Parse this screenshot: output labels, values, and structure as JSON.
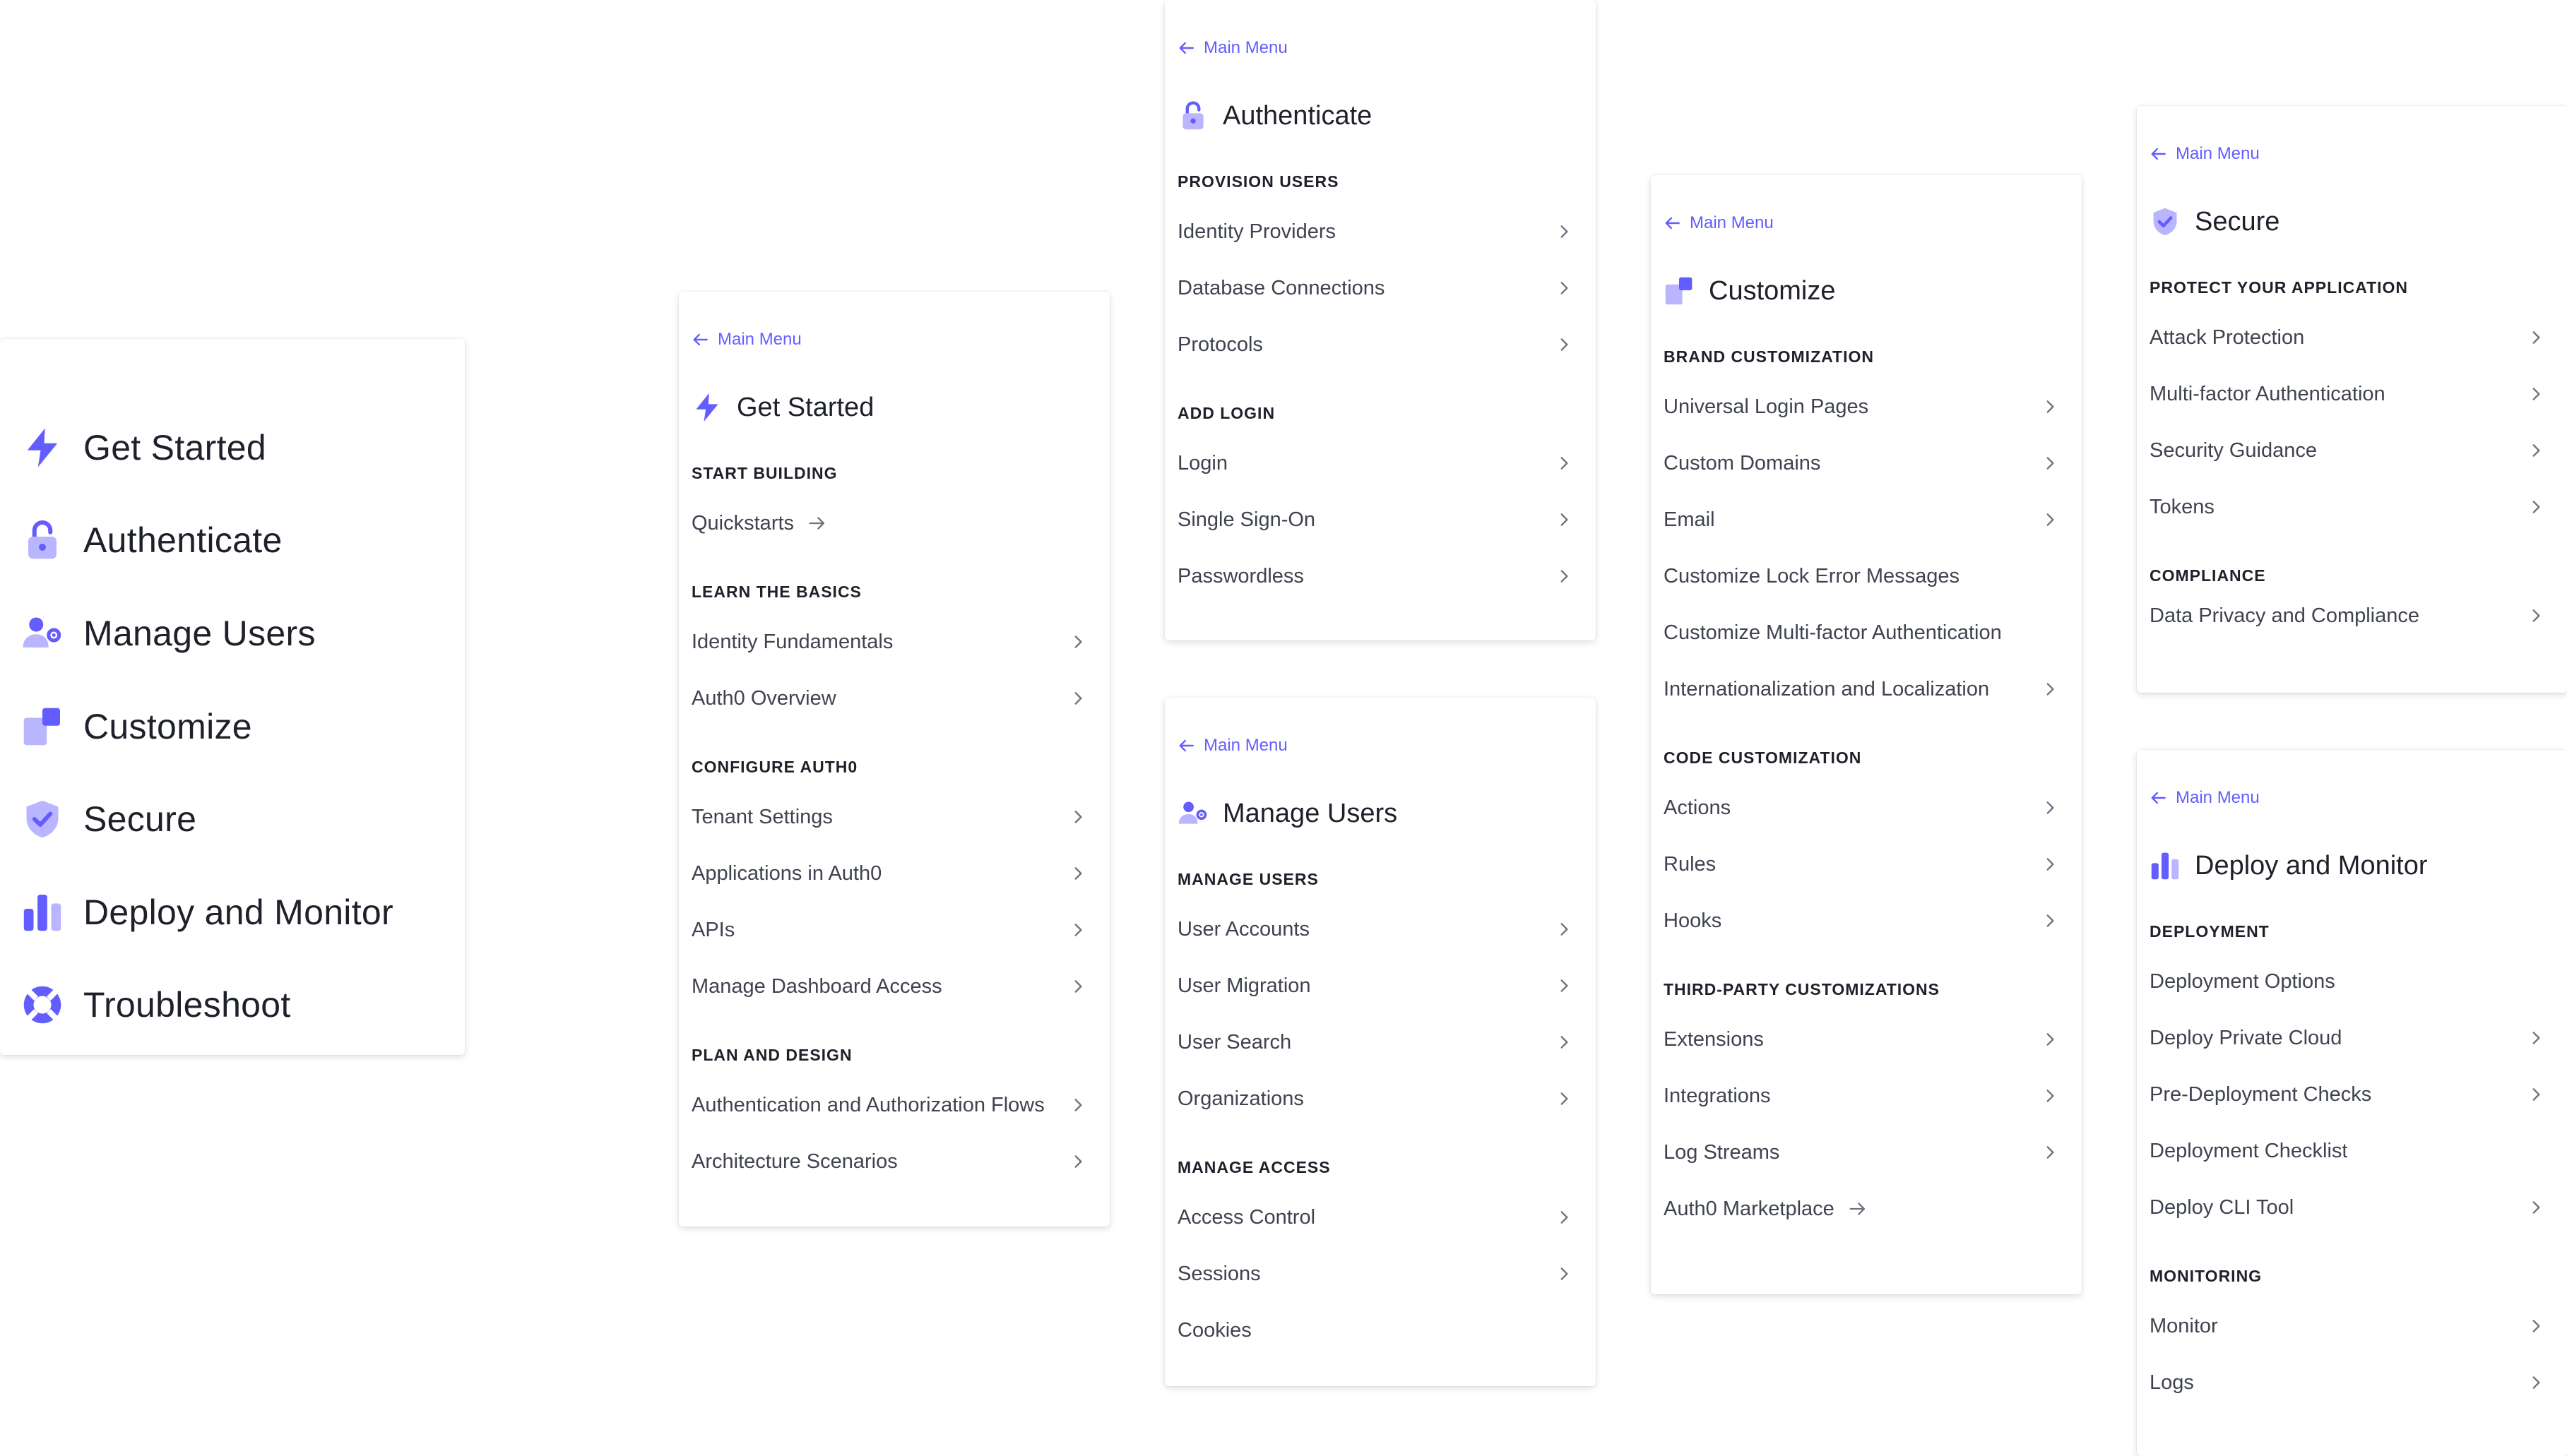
{
  "colors": {
    "accent": "#635dff",
    "accent_light": "#b9b6ff",
    "text": "#1e212a",
    "muted": "#3f4350"
  },
  "main_menu": {
    "items": [
      {
        "label": "Get Started",
        "icon": "lightning-icon"
      },
      {
        "label": "Authenticate",
        "icon": "unlock-icon"
      },
      {
        "label": "Manage Users",
        "icon": "user-gear-icon"
      },
      {
        "label": "Customize",
        "icon": "customize-icon"
      },
      {
        "label": "Secure",
        "icon": "shield-check-icon"
      },
      {
        "label": "Deploy and Monitor",
        "icon": "bar-chart-icon"
      },
      {
        "label": "Troubleshoot",
        "icon": "life-ring-icon"
      }
    ]
  },
  "back_label": "Main Menu",
  "get_started": {
    "title": "Get Started",
    "sections": [
      {
        "heading": "START BUILDING",
        "items": [
          {
            "label": "Quickstarts"
          }
        ]
      },
      {
        "heading": "LEARN THE BASICS",
        "items": [
          {
            "label": "Identity Fundamentals"
          },
          {
            "label": "Auth0 Overview"
          }
        ]
      },
      {
        "heading": "CONFIGURE AUTH0",
        "items": [
          {
            "label": "Tenant Settings"
          },
          {
            "label": "Applications in Auth0"
          },
          {
            "label": "APIs"
          },
          {
            "label": "Manage Dashboard Access"
          }
        ]
      },
      {
        "heading": "PLAN AND DESIGN",
        "items": [
          {
            "label": "Authentication and Authorization Flows"
          },
          {
            "label": "Architecture Scenarios"
          }
        ]
      }
    ]
  },
  "authenticate": {
    "title": "Authenticate",
    "sections": [
      {
        "heading": "PROVISION USERS",
        "items": [
          {
            "label": "Identity Providers"
          },
          {
            "label": "Database Connections"
          },
          {
            "label": "Protocols"
          }
        ]
      },
      {
        "heading": "ADD LOGIN",
        "items": [
          {
            "label": "Login"
          },
          {
            "label": "Single Sign-On"
          },
          {
            "label": "Passwordless"
          }
        ]
      }
    ]
  },
  "manage_users": {
    "title": "Manage Users",
    "sections": [
      {
        "heading": "MANAGE USERS",
        "items": [
          {
            "label": "User Accounts"
          },
          {
            "label": "User Migration"
          },
          {
            "label": "User Search"
          },
          {
            "label": "Organizations"
          }
        ]
      },
      {
        "heading": "MANAGE ACCESS",
        "items": [
          {
            "label": "Access Control"
          },
          {
            "label": "Sessions"
          },
          {
            "label": "Cookies"
          }
        ]
      }
    ]
  },
  "customize": {
    "title": "Customize",
    "sections": [
      {
        "heading": "BRAND CUSTOMIZATION",
        "items": [
          {
            "label": "Universal Login Pages"
          },
          {
            "label": "Custom Domains"
          },
          {
            "label": "Email"
          },
          {
            "label": "Customize Lock Error Messages"
          },
          {
            "label": "Customize Multi-factor Authentication"
          },
          {
            "label": "Internationalization and Localization"
          }
        ]
      },
      {
        "heading": "CODE CUSTOMIZATION",
        "items": [
          {
            "label": "Actions"
          },
          {
            "label": "Rules"
          },
          {
            "label": "Hooks"
          }
        ]
      },
      {
        "heading": "THIRD-PARTY CUSTOMIZATIONS",
        "items": [
          {
            "label": "Extensions"
          },
          {
            "label": "Integrations"
          },
          {
            "label": "Log Streams"
          },
          {
            "label": "Auth0 Marketplace"
          }
        ]
      }
    ]
  },
  "secure": {
    "title": "Secure",
    "sections": [
      {
        "heading": "PROTECT YOUR APPLICATION",
        "items": [
          {
            "label": "Attack Protection"
          },
          {
            "label": "Multi-factor Authentication"
          },
          {
            "label": "Security Guidance"
          },
          {
            "label": "Tokens"
          }
        ]
      },
      {
        "heading": "COMPLIANCE",
        "items": [
          {
            "label": "Data Privacy and Compliance"
          }
        ]
      }
    ]
  },
  "deploy_monitor": {
    "title": "Deploy and Monitor",
    "sections": [
      {
        "heading": "DEPLOYMENT",
        "items": [
          {
            "label": "Deployment Options"
          },
          {
            "label": "Deploy Private Cloud"
          },
          {
            "label": "Pre-Deployment Checks"
          },
          {
            "label": "Deployment Checklist"
          },
          {
            "label": "Deploy CLI Tool"
          }
        ]
      },
      {
        "heading": "MONITORING",
        "items": [
          {
            "label": "Monitor"
          },
          {
            "label": "Logs"
          }
        ]
      }
    ]
  }
}
